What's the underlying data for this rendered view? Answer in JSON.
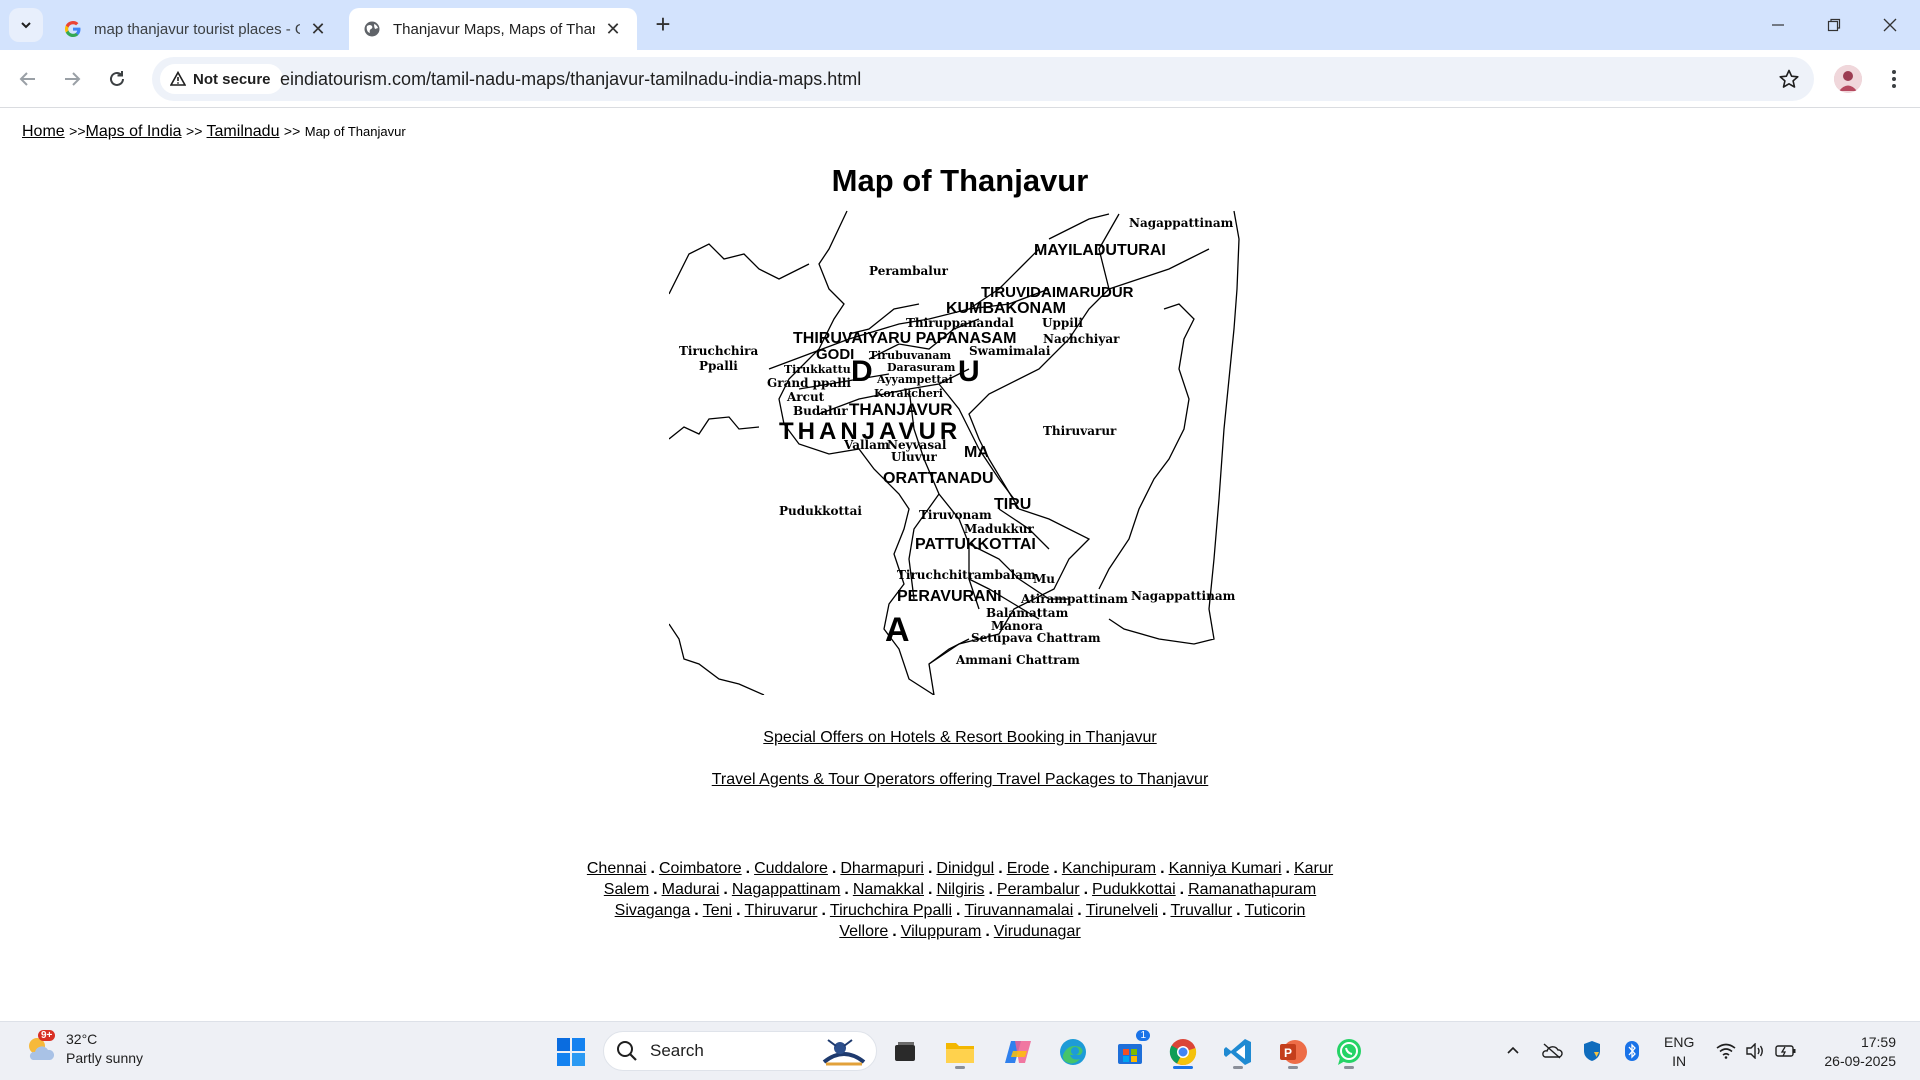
{
  "browser": {
    "tabs": [
      {
        "title": "map thanjavur tourist places - G",
        "active": false
      },
      {
        "title": "Thanjavur Maps, Maps of Thanj",
        "active": true
      }
    ],
    "security_chip": "Not secure",
    "url": "eindiatourism.com/tamil-nadu-maps/thanjavur-tamilnadu-india-maps.html"
  },
  "page": {
    "breadcrumb": {
      "home": "Home",
      "sep1": ">>",
      "maps_of_india": "Maps of India",
      "sep2": ">>",
      "tamilnadu": "Tamilnadu",
      "sep3": ">>",
      "current": "Map of Thanjavur"
    },
    "title": "Map of Thanjavur",
    "map_labels": {
      "nagappattinam_top": "Nagappattinam",
      "mayiladuturai": "MAYILADUTURAI",
      "perambalur": "Perambalur",
      "tiruvidaimarudur": "TIRUVIDAIMARUDUR",
      "kumbakonam": "KUMBAKONAM",
      "thiruppanandal": "Thiruppanandal",
      "uppili": "Uppili",
      "thiruvaiyaru_papanasam": "THIRUVAIYARU PAPANASAM",
      "nachchiyar": "Nachchiyar",
      "swamimalai": "Swamimalai",
      "tiruchchirappalli": "Tiruchchira Ppalli",
      "godi": "GODI",
      "tirubuvanam": "Tirubuvanam",
      "darasuram": "Darasuram",
      "tirukkattu": "Tirukkattu",
      "ayyampettai": "Ayyampettai",
      "grand_anicut": "Grand    ppalli",
      "korakcheri": "Korakcheri",
      "arcut": "Arcut",
      "budalur": "Budalur",
      "thanjavur_small": "THANJAVUR",
      "thanjavur_big": "THANJAVUR",
      "letter_d": "D",
      "letter_u": "U",
      "thiruvarur": "Thiruvarur",
      "vallam": "Vallam",
      "neyvasal": "Neyvasal",
      "uluvur": "Uluvur",
      "mannargudi": "MA",
      "orattanadu": "ORATTANADU",
      "tiru": "TIRU",
      "pudukkottai": "Pudukkottai",
      "tiruvonam": "Tiruvonam",
      "madukkur": "Madukkur",
      "pattukkottai": "PATTUKKOTTAI",
      "tiruchchitrambalam": "Tiruchchitrambalam",
      "muthupet": "Mu",
      "peravurani": "PERAVURANI",
      "atirampattinam": "Atirampattinam",
      "nagappattinam_bottom": "Nagappattinam",
      "balamattam": "Balamattam",
      "manora": "Manora",
      "letter_a": "A",
      "setupava_chattram": "Setupava  Chattram",
      "ammani_chattram": "Ammani Chattram"
    },
    "links": {
      "hotels": "Special Offers on Hotels & Resort Booking in Thanjavur",
      "travel_agents": "Travel Agents & Tour Operators offering Travel Packages to Thanjavur"
    },
    "cities": [
      "Chennai",
      "Coimbatore",
      "Cuddalore",
      "Dharmapuri",
      "Dinidgul",
      "Erode",
      "Kanchipuram",
      "Kanniya Kumari",
      "Karur",
      "Salem",
      "Madurai",
      "Nagappattinam",
      "Namakkal",
      "Nilgiris",
      "Perambalur",
      "Pudukkottai",
      "Ramanathapuram",
      "Sivaganga",
      "Teni",
      "Thiruvarur",
      "Tiruchchira Ppalli",
      "Tiruvannamalai",
      "Tirunelveli",
      "Truvallur",
      "Tuticorin",
      "Vellore",
      "Viluppuram",
      "Virudunagar"
    ],
    "city_separator": "."
  },
  "taskbar": {
    "weather_badge": "9+",
    "temperature": "32°C",
    "condition": "Partly sunny",
    "search_label": "Search",
    "store_badge": "1",
    "lang_top": "ENG",
    "lang_bottom": "IN",
    "time": "17:59",
    "date": "26-09-2025"
  },
  "colors": {
    "tabstrip": "#d3e3fd",
    "omnibox": "#eef2f9",
    "taskbar": "#eef0f5",
    "accent": "#1a73e8"
  },
  "icons": [
    "tab-search-icon",
    "google-favicon",
    "globe-favicon",
    "close-icon",
    "plus-icon",
    "minimize-icon",
    "maximize-icon",
    "window-close-icon",
    "back-icon",
    "forward-icon",
    "reload-icon",
    "warning-icon",
    "star-icon",
    "avatar",
    "kebab-icon",
    "weather-icon",
    "windows-start-icon",
    "search-icon",
    "task-view-icon",
    "file-explorer-icon",
    "copilot-icon",
    "edge-icon",
    "store-icon",
    "chrome-icon",
    "vscode-icon",
    "powerpoint-icon",
    "whatsapp-icon",
    "chevron-up-icon",
    "onedrive-icon",
    "defender-icon",
    "bluetooth-icon",
    "wifi-icon",
    "volume-icon",
    "battery-icon"
  ]
}
